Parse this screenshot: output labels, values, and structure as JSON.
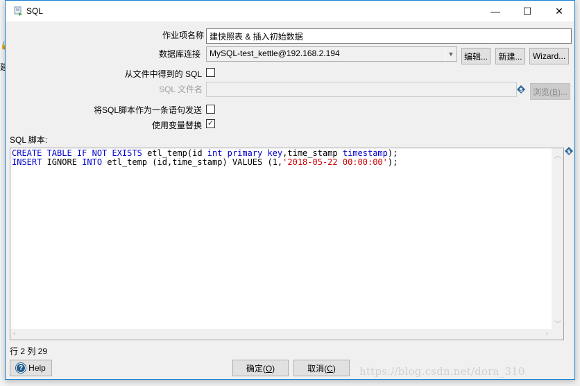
{
  "background": {
    "lock_icon": "lock-icon",
    "partial_char": "建"
  },
  "window": {
    "title": "SQL",
    "icon": "sql-script-icon",
    "controls": {
      "minimize": "—",
      "maximize": "☐",
      "close": "✕"
    }
  },
  "form": {
    "job_entry_name": {
      "label": "作业项名称",
      "value": "建快照表 & 插入初始数据"
    },
    "connection": {
      "label": "数据库连接",
      "selected": "MySQL-test_kettle@192.168.2.194",
      "edit_label": "编辑...",
      "edit_mnemonic": "编",
      "new_label": "新建...",
      "new_mnemonic": "新",
      "wizard_label": "Wizard..."
    },
    "sql_from_file": {
      "label": "从文件中得到的 SQL",
      "checked": false
    },
    "sql_filename": {
      "label": "SQL 文件名",
      "value": "",
      "disabled": true,
      "browse_label": "浏览(B)...",
      "browse_prefix": "浏览(",
      "browse_mnemonic": "B",
      "browse_suffix": ")..."
    },
    "send_as_single_statement": {
      "label": "将SQL脚本作为一条语句发送",
      "checked": false
    },
    "use_variable_substitution": {
      "label": "使用变量替换",
      "checked": true
    },
    "sql_script": {
      "label": "SQL 脚本:",
      "lines": [
        [
          {
            "t": "CREATE TABLE IF NOT EXISTS",
            "k": "kw"
          },
          {
            "t": " etl_temp(id ",
            "k": "plain"
          },
          {
            "t": "int primary key",
            "k": "kw"
          },
          {
            "t": ",time_stamp ",
            "k": "plain"
          },
          {
            "t": "timestamp",
            "k": "kw"
          },
          {
            "t": ");",
            "k": "plain"
          }
        ],
        [
          {
            "t": "INSERT",
            "k": "kw"
          },
          {
            "t": " IGNORE ",
            "k": "plain"
          },
          {
            "t": "INTO",
            "k": "kw"
          },
          {
            "t": " etl_temp (id,time_stamp) VALUES (1,",
            "k": "plain"
          },
          {
            "t": "'2018-05-22 00:00:00'",
            "k": "str"
          },
          {
            "t": ");",
            "k": "plain"
          }
        ]
      ]
    }
  },
  "status": {
    "cursor_position": "行 2 列 29"
  },
  "footer": {
    "help_label": "Help",
    "ok_prefix": "确定(",
    "ok_mnemonic": "O",
    "ok_suffix": ")",
    "cancel_prefix": "取消(",
    "cancel_mnemonic": "C",
    "cancel_suffix": ")"
  },
  "watermark": "https://blog.csdn.net/dora_310",
  "colors": {
    "keyword": "#0000cc",
    "string": "#cc0000",
    "window_border": "#1883d7"
  }
}
